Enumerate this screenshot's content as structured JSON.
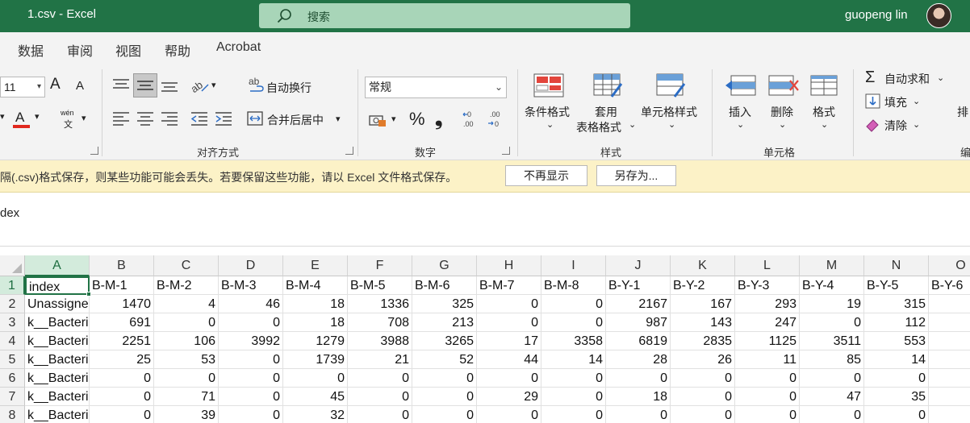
{
  "window": {
    "title": "1.csv  -  Excel",
    "search_placeholder": "搜索",
    "user_name": "guopeng lin"
  },
  "tabs": [
    "数据",
    "审阅",
    "视图",
    "帮助",
    "Acrobat"
  ],
  "ribbon": {
    "font_size": "11",
    "wrap_text": "自动换行",
    "merge_center": "合并后居中",
    "number_format": "常规",
    "conditional_format": "条件格式",
    "table_format_line1": "套用",
    "table_format_line2": "表格格式",
    "cell_styles": "单元格样式",
    "insert": "插入",
    "delete": "删除",
    "format": "格式",
    "autosum": "自动求和",
    "fill": "填充",
    "clear": "清除",
    "sort_partial": "排",
    "groups": {
      "alignment": "对齐方式",
      "number": "数字",
      "styles": "样式",
      "cells": "单元格",
      "editing_partial": "编"
    },
    "glyphs": {
      "grow": "A",
      "shrink": "A",
      "percent": "%",
      "comma": "❟",
      "wen": "wén",
      "wen_char": "文",
      "abc": "ab",
      "font_color": "A"
    }
  },
  "infobar": {
    "message": "隔(.csv)格式保存，则某些功能可能会丢失。若要保留这些功能，请以 Excel 文件格式保存。",
    "dont_show": "不再显示",
    "save_as": "另存为..."
  },
  "formula_bar": {
    "content": "dex"
  },
  "sheet": {
    "columns": [
      "A",
      "B",
      "C",
      "D",
      "E",
      "F",
      "G",
      "H",
      "I",
      "J",
      "K",
      "L",
      "M",
      "N",
      "O"
    ],
    "row_numbers": [
      "1",
      "2",
      "3",
      "4",
      "5",
      "6",
      "7",
      "8"
    ],
    "rows": [
      [
        "index",
        "B-M-1",
        "B-M-2",
        "B-M-3",
        "B-M-4",
        "B-M-5",
        "B-M-6",
        "B-M-7",
        "B-M-8",
        "B-Y-1",
        "B-Y-2",
        "B-Y-3",
        "B-Y-4",
        "B-Y-5",
        "B-Y-6"
      ],
      [
        "Unassigned",
        "1470",
        "4",
        "46",
        "18",
        "1336",
        "325",
        "0",
        "0",
        "2167",
        "167",
        "293",
        "19",
        "315",
        ""
      ],
      [
        "k__Bacteria",
        "691",
        "0",
        "0",
        "18",
        "708",
        "213",
        "0",
        "0",
        "987",
        "143",
        "247",
        "0",
        "112",
        ""
      ],
      [
        "k__Bacteria",
        "2251",
        "106",
        "3992",
        "1279",
        "3988",
        "3265",
        "17",
        "3358",
        "6819",
        "2835",
        "1125",
        "3511",
        "553",
        ""
      ],
      [
        "k__Bacteria",
        "25",
        "53",
        "0",
        "1739",
        "21",
        "52",
        "44",
        "14",
        "28",
        "26",
        "11",
        "85",
        "14",
        ""
      ],
      [
        "k__Bacteria",
        "0",
        "0",
        "0",
        "0",
        "0",
        "0",
        "0",
        "0",
        "0",
        "0",
        "0",
        "0",
        "0",
        ""
      ],
      [
        "k__Bacteria",
        "0",
        "71",
        "0",
        "45",
        "0",
        "0",
        "29",
        "0",
        "18",
        "0",
        "0",
        "47",
        "35",
        ""
      ],
      [
        "k__Bacteria",
        "0",
        "39",
        "0",
        "32",
        "0",
        "0",
        "0",
        "0",
        "0",
        "0",
        "0",
        "0",
        "0",
        ""
      ]
    ]
  },
  "colors": {
    "excel_green": "#217346",
    "search_bg": "#a8d5b8",
    "infobar_bg": "#fcf2c7",
    "ribbon_bg": "#f3f3f3"
  }
}
